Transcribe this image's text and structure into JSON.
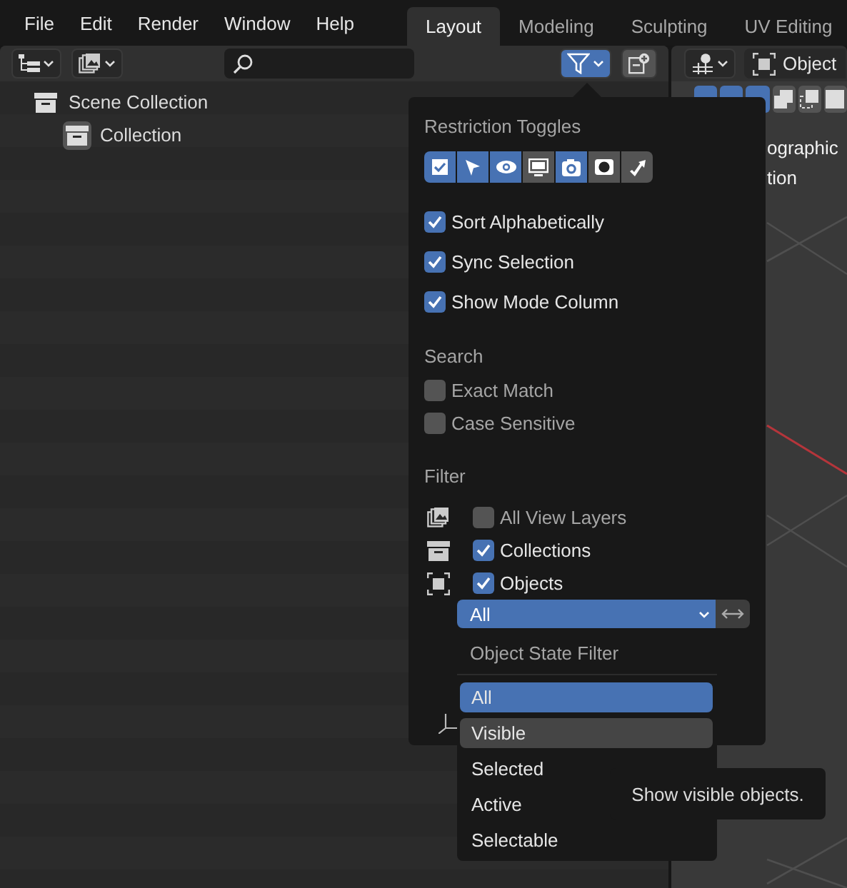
{
  "menu_bar": {
    "items": [
      "File",
      "Edit",
      "Render",
      "Window",
      "Help"
    ]
  },
  "workspace_tabs": [
    {
      "label": "Layout",
      "selected": true
    },
    {
      "label": "Modeling",
      "selected": false
    },
    {
      "label": "Sculpting",
      "selected": false
    },
    {
      "label": "UV Editing",
      "selected": false
    }
  ],
  "outliner": {
    "filter_open": true,
    "tree": [
      {
        "label": "Scene Collection",
        "kind": "scene",
        "children": [
          {
            "label": "Collection",
            "kind": "collection",
            "active": true
          }
        ]
      }
    ]
  },
  "viewport": {
    "mode": "Object",
    "overlay_text": [
      "ographic",
      "tion"
    ]
  },
  "filter_popover": {
    "restriction_title": "Restriction Toggles",
    "restriction_toggles": [
      {
        "kind": "checkbox",
        "on": true
      },
      {
        "kind": "select",
        "on": true
      },
      {
        "kind": "eye",
        "on": true
      },
      {
        "kind": "monitor",
        "on": false
      },
      {
        "kind": "camera",
        "on": true
      },
      {
        "kind": "holdout",
        "on": false
      },
      {
        "kind": "indirect",
        "on": false
      }
    ],
    "options": [
      {
        "label": "Sort Alphabetically",
        "checked": true
      },
      {
        "label": "Sync Selection",
        "checked": true
      },
      {
        "label": "Show Mode Column",
        "checked": true
      }
    ],
    "search": {
      "title": "Search",
      "options": [
        {
          "label": "Exact Match",
          "checked": false
        },
        {
          "label": "Case Sensitive",
          "checked": false
        }
      ]
    },
    "filter": {
      "title": "Filter",
      "options": [
        {
          "label": "All View Layers",
          "kind": "layers",
          "checked": false
        },
        {
          "label": "Collections",
          "kind": "collection",
          "checked": true
        },
        {
          "label": "Objects",
          "kind": "object",
          "checked": true
        }
      ]
    },
    "object_state": {
      "value": "All"
    }
  },
  "object_state_menu": {
    "title": "Object State Filter",
    "items": [
      {
        "label": "All",
        "selected": true,
        "hovered": false
      },
      {
        "label": "Visible",
        "selected": false,
        "hovered": true
      },
      {
        "label": "Selected",
        "selected": false,
        "hovered": false
      },
      {
        "label": "Active",
        "selected": false,
        "hovered": false
      },
      {
        "label": "Selectable",
        "selected": false,
        "hovered": false
      }
    ]
  },
  "tooltip": {
    "text": "Show visible objects."
  }
}
